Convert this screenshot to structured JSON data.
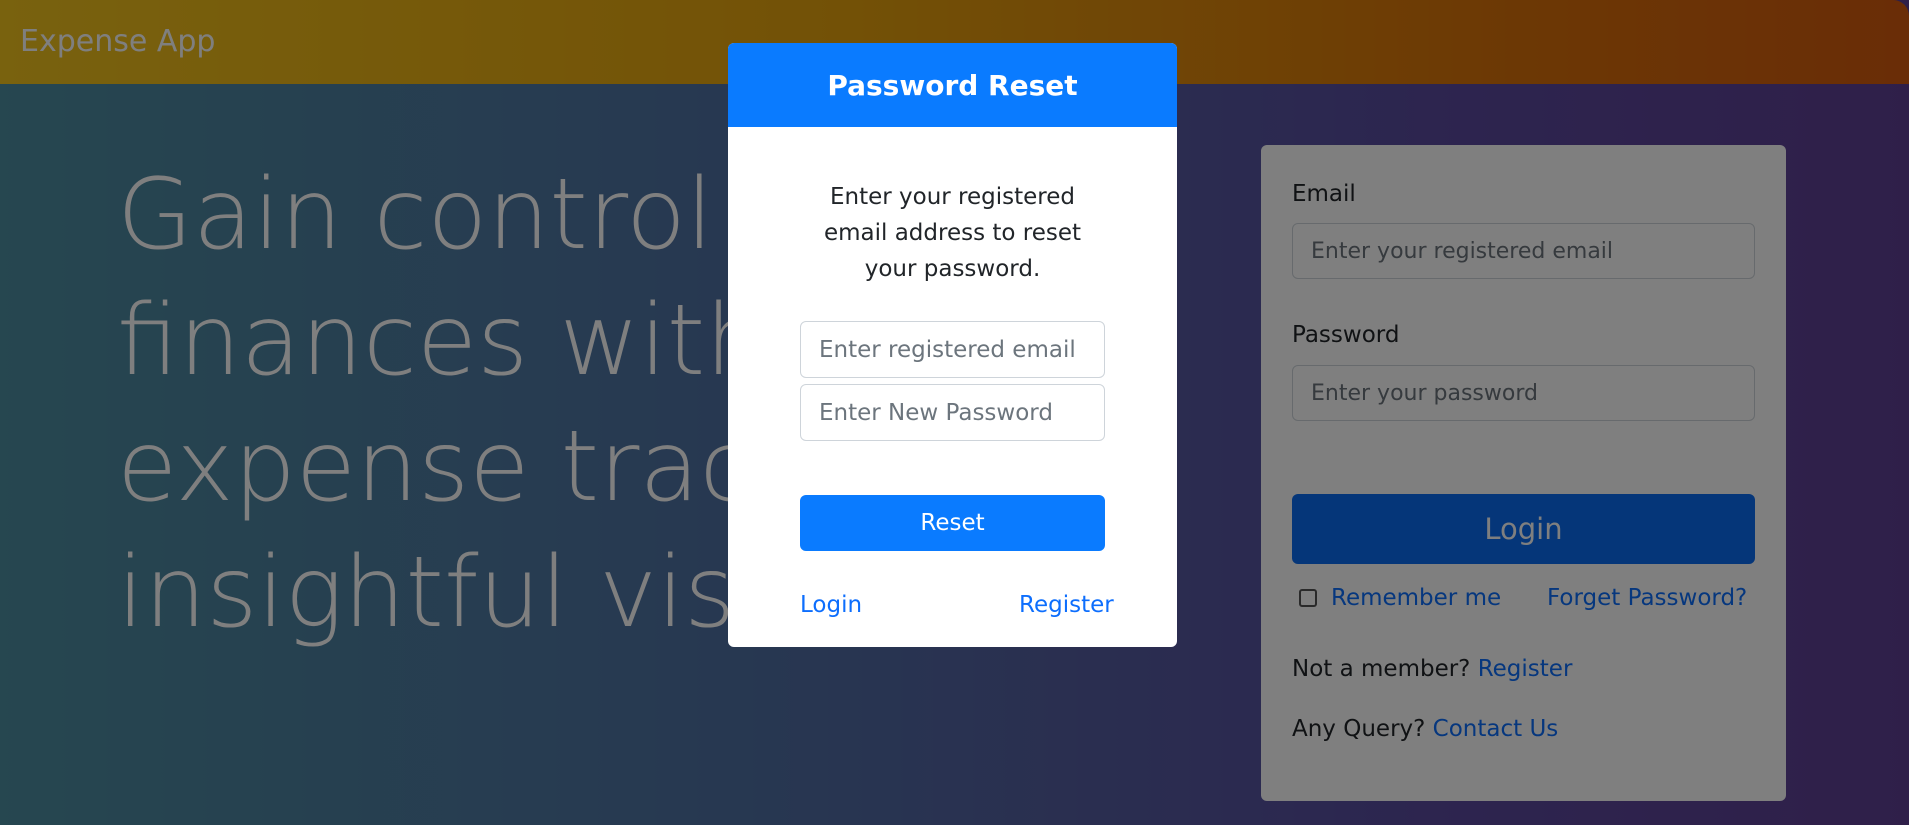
{
  "navbar": {
    "brand": "Expense App"
  },
  "hero": {
    "line1": "Gain control of",
    "line2": "finances with p",
    "line3": "expense tracki",
    "line4": "insightful visua"
  },
  "login_form": {
    "email_label": "Email",
    "email_placeholder": "Enter your registered email",
    "password_label": "Password",
    "password_placeholder": "Enter your password",
    "login_label": "Login",
    "remember_label": "Remember me",
    "forget_label": "Forget Password?",
    "member_prefix": "Not a member?",
    "register_link": "Register",
    "query_prefix": "Any Query?",
    "contact_link": "Contact Us"
  },
  "modal": {
    "title": "Password Reset",
    "description": "Enter your registered email address to reset your password.",
    "email_placeholder": "Enter registered email",
    "password_placeholder": "Enter New Password",
    "reset_label": "Reset",
    "login_link": "Login",
    "register_link": "Register"
  },
  "colors": {
    "primary": "#0a7bff",
    "link": "#0d6efd"
  }
}
